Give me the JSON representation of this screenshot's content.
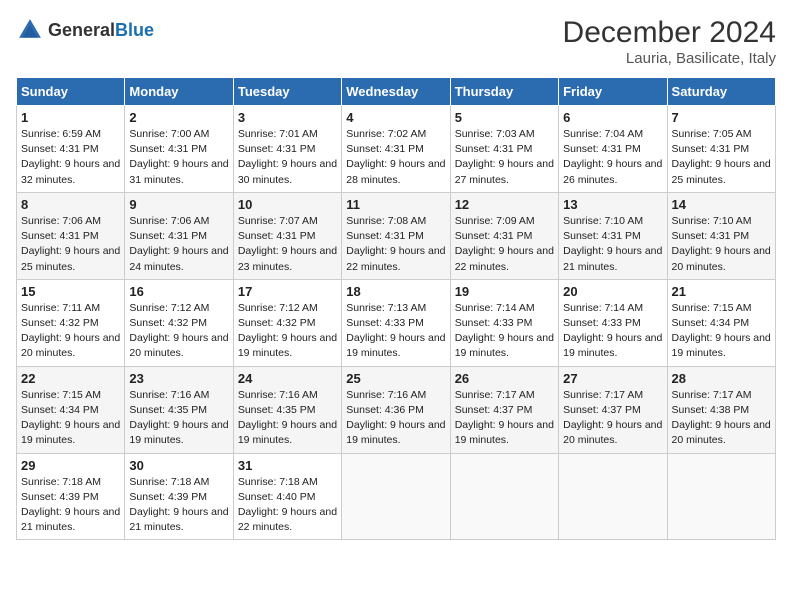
{
  "logo": {
    "text_general": "General",
    "text_blue": "Blue"
  },
  "title": "December 2024",
  "subtitle": "Lauria, Basilicate, Italy",
  "days_of_week": [
    "Sunday",
    "Monday",
    "Tuesday",
    "Wednesday",
    "Thursday",
    "Friday",
    "Saturday"
  ],
  "weeks": [
    [
      {
        "day": 1,
        "sunrise": "6:59 AM",
        "sunset": "4:31 PM",
        "daylight": "9 hours and 32 minutes."
      },
      {
        "day": 2,
        "sunrise": "7:00 AM",
        "sunset": "4:31 PM",
        "daylight": "9 hours and 31 minutes."
      },
      {
        "day": 3,
        "sunrise": "7:01 AM",
        "sunset": "4:31 PM",
        "daylight": "9 hours and 30 minutes."
      },
      {
        "day": 4,
        "sunrise": "7:02 AM",
        "sunset": "4:31 PM",
        "daylight": "9 hours and 28 minutes."
      },
      {
        "day": 5,
        "sunrise": "7:03 AM",
        "sunset": "4:31 PM",
        "daylight": "9 hours and 27 minutes."
      },
      {
        "day": 6,
        "sunrise": "7:04 AM",
        "sunset": "4:31 PM",
        "daylight": "9 hours and 26 minutes."
      },
      {
        "day": 7,
        "sunrise": "7:05 AM",
        "sunset": "4:31 PM",
        "daylight": "9 hours and 25 minutes."
      }
    ],
    [
      {
        "day": 8,
        "sunrise": "7:06 AM",
        "sunset": "4:31 PM",
        "daylight": "9 hours and 25 minutes."
      },
      {
        "day": 9,
        "sunrise": "7:06 AM",
        "sunset": "4:31 PM",
        "daylight": "9 hours and 24 minutes."
      },
      {
        "day": 10,
        "sunrise": "7:07 AM",
        "sunset": "4:31 PM",
        "daylight": "9 hours and 23 minutes."
      },
      {
        "day": 11,
        "sunrise": "7:08 AM",
        "sunset": "4:31 PM",
        "daylight": "9 hours and 22 minutes."
      },
      {
        "day": 12,
        "sunrise": "7:09 AM",
        "sunset": "4:31 PM",
        "daylight": "9 hours and 22 minutes."
      },
      {
        "day": 13,
        "sunrise": "7:10 AM",
        "sunset": "4:31 PM",
        "daylight": "9 hours and 21 minutes."
      },
      {
        "day": 14,
        "sunrise": "7:10 AM",
        "sunset": "4:31 PM",
        "daylight": "9 hours and 20 minutes."
      }
    ],
    [
      {
        "day": 15,
        "sunrise": "7:11 AM",
        "sunset": "4:32 PM",
        "daylight": "9 hours and 20 minutes."
      },
      {
        "day": 16,
        "sunrise": "7:12 AM",
        "sunset": "4:32 PM",
        "daylight": "9 hours and 20 minutes."
      },
      {
        "day": 17,
        "sunrise": "7:12 AM",
        "sunset": "4:32 PM",
        "daylight": "9 hours and 19 minutes."
      },
      {
        "day": 18,
        "sunrise": "7:13 AM",
        "sunset": "4:33 PM",
        "daylight": "9 hours and 19 minutes."
      },
      {
        "day": 19,
        "sunrise": "7:14 AM",
        "sunset": "4:33 PM",
        "daylight": "9 hours and 19 minutes."
      },
      {
        "day": 20,
        "sunrise": "7:14 AM",
        "sunset": "4:33 PM",
        "daylight": "9 hours and 19 minutes."
      },
      {
        "day": 21,
        "sunrise": "7:15 AM",
        "sunset": "4:34 PM",
        "daylight": "9 hours and 19 minutes."
      }
    ],
    [
      {
        "day": 22,
        "sunrise": "7:15 AM",
        "sunset": "4:34 PM",
        "daylight": "9 hours and 19 minutes."
      },
      {
        "day": 23,
        "sunrise": "7:16 AM",
        "sunset": "4:35 PM",
        "daylight": "9 hours and 19 minutes."
      },
      {
        "day": 24,
        "sunrise": "7:16 AM",
        "sunset": "4:35 PM",
        "daylight": "9 hours and 19 minutes."
      },
      {
        "day": 25,
        "sunrise": "7:16 AM",
        "sunset": "4:36 PM",
        "daylight": "9 hours and 19 minutes."
      },
      {
        "day": 26,
        "sunrise": "7:17 AM",
        "sunset": "4:37 PM",
        "daylight": "9 hours and 19 minutes."
      },
      {
        "day": 27,
        "sunrise": "7:17 AM",
        "sunset": "4:37 PM",
        "daylight": "9 hours and 20 minutes."
      },
      {
        "day": 28,
        "sunrise": "7:17 AM",
        "sunset": "4:38 PM",
        "daylight": "9 hours and 20 minutes."
      }
    ],
    [
      {
        "day": 29,
        "sunrise": "7:18 AM",
        "sunset": "4:39 PM",
        "daylight": "9 hours and 21 minutes."
      },
      {
        "day": 30,
        "sunrise": "7:18 AM",
        "sunset": "4:39 PM",
        "daylight": "9 hours and 21 minutes."
      },
      {
        "day": 31,
        "sunrise": "7:18 AM",
        "sunset": "4:40 PM",
        "daylight": "9 hours and 22 minutes."
      },
      null,
      null,
      null,
      null
    ]
  ]
}
